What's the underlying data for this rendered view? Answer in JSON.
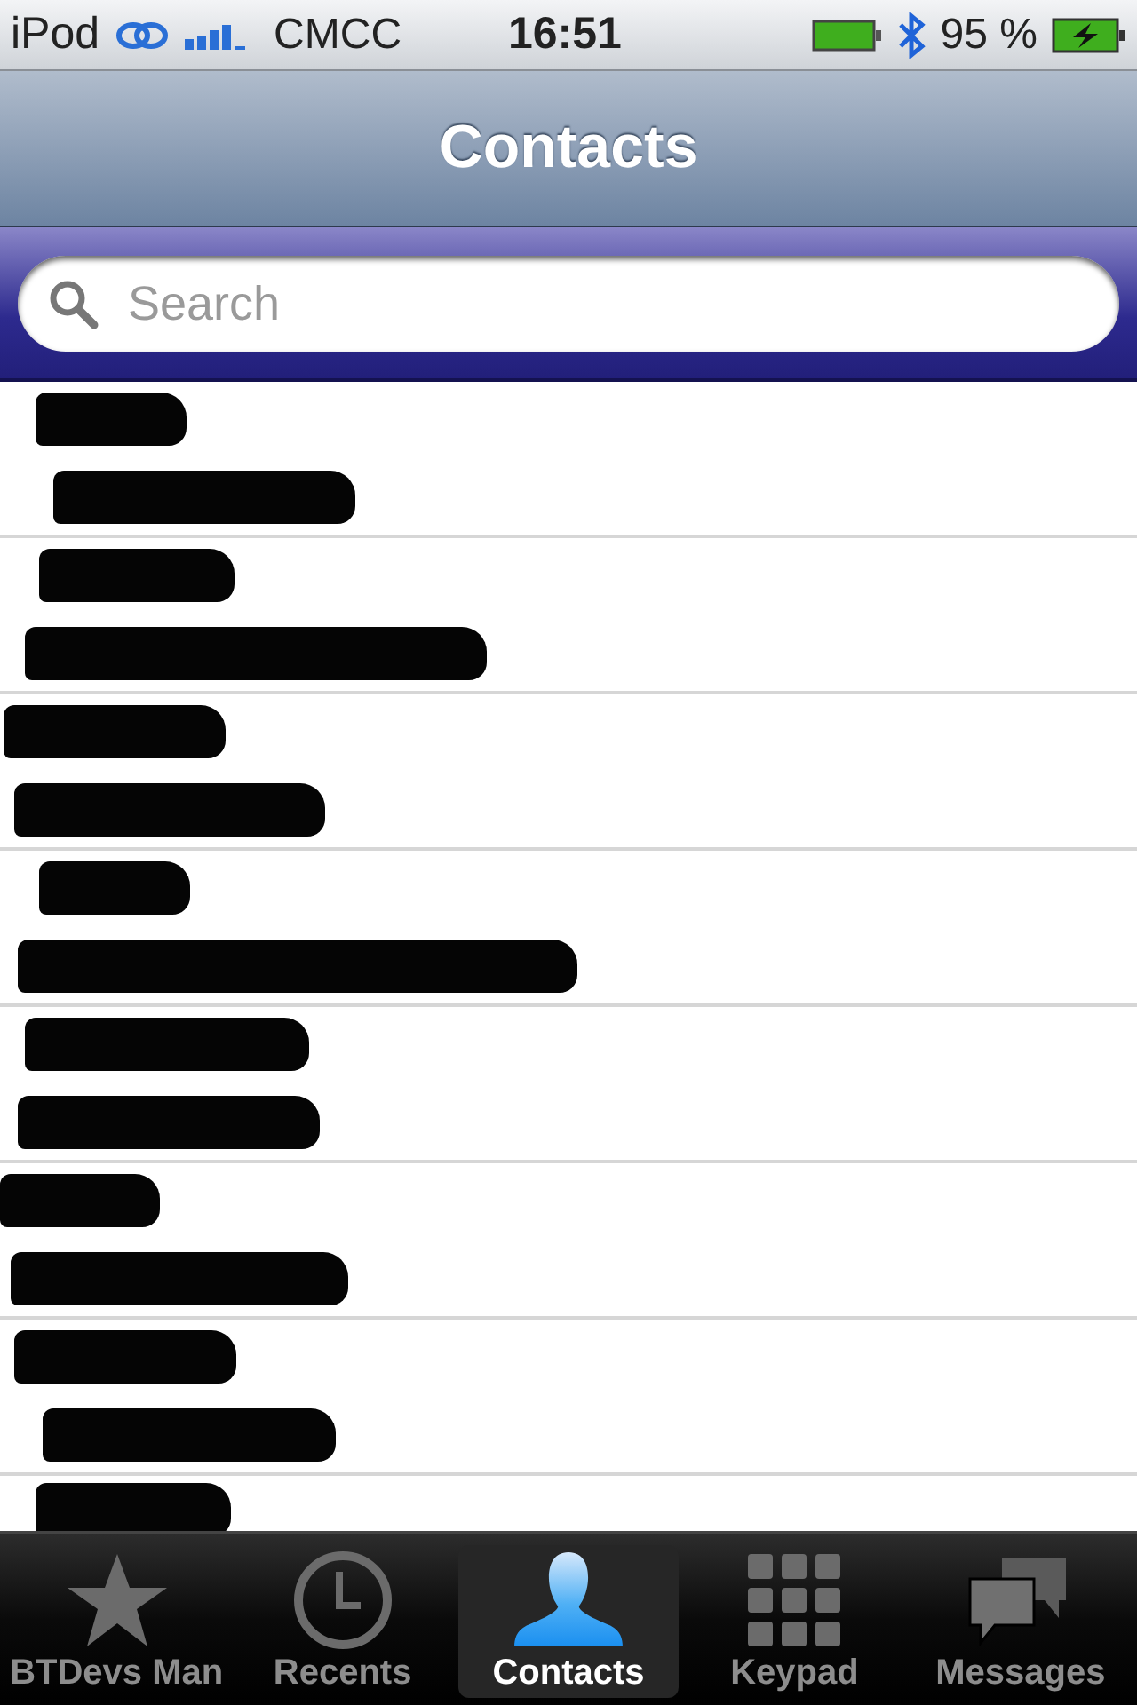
{
  "status_bar": {
    "device": "iPod",
    "carrier": "CMCC",
    "time": "16:51",
    "battery_percent": "95 %"
  },
  "nav_bar": {
    "title": "Contacts"
  },
  "search": {
    "placeholder": "Search"
  },
  "contacts": [
    {
      "kind": "redacted"
    },
    {
      "kind": "redacted"
    },
    {
      "kind": "redacted"
    },
    {
      "kind": "redacted"
    },
    {
      "kind": "redacted"
    },
    {
      "kind": "redacted"
    },
    {
      "kind": "redacted"
    },
    {
      "kind": "redacted"
    }
  ],
  "tabs": [
    {
      "label": "BTDevs Man",
      "kind": "star",
      "selected": false
    },
    {
      "label": "Recents",
      "kind": "clock",
      "selected": false
    },
    {
      "label": "Contacts",
      "kind": "person",
      "selected": true
    },
    {
      "label": "Keypad",
      "kind": "keypad",
      "selected": false
    },
    {
      "label": "Messages",
      "kind": "bubbles",
      "selected": false
    }
  ]
}
